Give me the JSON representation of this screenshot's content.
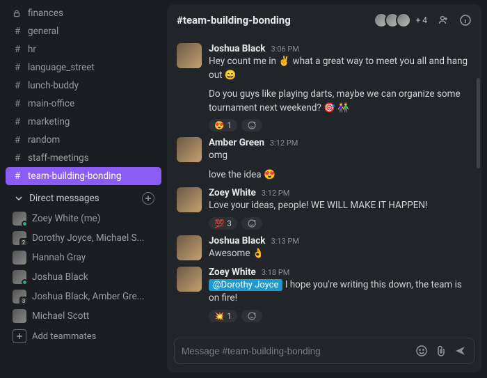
{
  "sidebar": {
    "channels": [
      {
        "icon": "lock",
        "name": "finances"
      },
      {
        "icon": "hash",
        "name": "general"
      },
      {
        "icon": "hash",
        "name": "hr"
      },
      {
        "icon": "hash",
        "name": "language_street"
      },
      {
        "icon": "hash",
        "name": "lunch-buddy"
      },
      {
        "icon": "hash",
        "name": "main-office"
      },
      {
        "icon": "hash",
        "name": "marketing"
      },
      {
        "icon": "hash",
        "name": "random"
      },
      {
        "icon": "hash",
        "name": "staff-meetings"
      },
      {
        "icon": "hash",
        "name": "team-building-bonding",
        "active": true
      }
    ],
    "dm_section_label": "Direct messages",
    "dms": [
      {
        "name": "Zoey White (me)",
        "badge": "online"
      },
      {
        "name": "Dorothy Joyce, Michael S...",
        "badge": "2"
      },
      {
        "name": "Hannah Gray",
        "badge": "none"
      },
      {
        "name": "Joshua Black",
        "badge": "online"
      },
      {
        "name": "Joshua Black, Amber Gre...",
        "badge": "3"
      },
      {
        "name": "Michael Scott",
        "badge": "none"
      }
    ],
    "add_teammates_label": "Add teammates"
  },
  "header": {
    "title": "#team-building-bonding",
    "extra_members": "+ 4"
  },
  "messages": [
    {
      "author": "Joshua Black",
      "time": "3:06 PM",
      "lines": [
        "Hey count me in ✌️ what a great way to meet you all and hang out 😄",
        "Do you guys like playing darts, maybe we can organize some tournament next weekend? 🎯 👫"
      ],
      "reactions": [
        {
          "emoji": "😍",
          "count": "1"
        },
        {
          "add": true
        }
      ]
    },
    {
      "author": "Amber Green",
      "time": "3:12 PM",
      "lines": [
        "omg",
        "love the idea 😍"
      ]
    },
    {
      "author": "Zoey White",
      "time": "3:12 PM",
      "lines": [
        "Love your ideas, people! WE WILL MAKE IT HAPPEN!"
      ],
      "reactions": [
        {
          "emoji": "💯",
          "count": "3"
        },
        {
          "add": true
        }
      ]
    },
    {
      "author": "Joshua Black",
      "time": "3:13 PM",
      "lines": [
        "Awesome 👌"
      ]
    },
    {
      "author": "Zoey White",
      "time": "3:18 PM",
      "mention": "@Dorothy Joyce",
      "after_mention": " I hope you're writing this down, the team is on fire!",
      "reactions": [
        {
          "emoji": "💥",
          "count": "1"
        },
        {
          "add": true
        }
      ]
    }
  ],
  "composer": {
    "placeholder": "Message #team-building-bonding"
  }
}
